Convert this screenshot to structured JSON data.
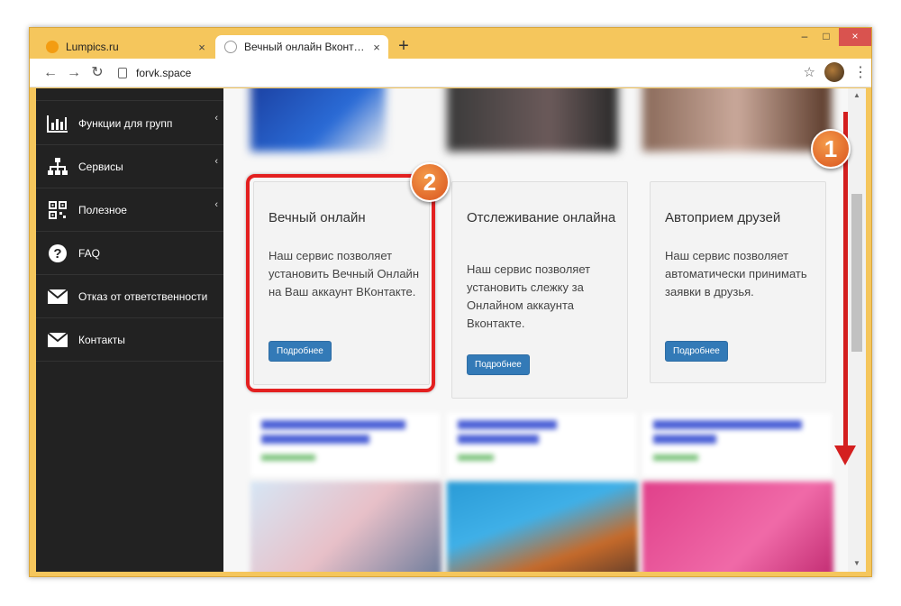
{
  "browser": {
    "tabs": [
      {
        "title": "Lumpics.ru",
        "close": "×",
        "active": false
      },
      {
        "title": "Вечный онлайн Вконтакте, Авто",
        "close": "×",
        "active": true
      }
    ],
    "new_tab": "+",
    "window_controls": {
      "minimize": "–",
      "maximize": "□",
      "close": "×"
    },
    "nav": {
      "back": "←",
      "forward": "→",
      "reload": "↻"
    },
    "url": "forvk.space",
    "star": "☆",
    "menu": "⋮"
  },
  "sidebar": {
    "items": [
      {
        "label": "Функции для групп",
        "icon": "bar-chart-icon",
        "has_submenu": true
      },
      {
        "label": "Сервисы",
        "icon": "sitemap-icon",
        "has_submenu": true
      },
      {
        "label": "Полезное",
        "icon": "qr-code-icon",
        "has_submenu": true
      },
      {
        "label": "FAQ",
        "icon": "question-circle-icon",
        "has_submenu": false
      },
      {
        "label": "Отказ от ответственности",
        "icon": "envelope-icon",
        "has_submenu": false
      },
      {
        "label": "Контакты",
        "icon": "envelope-icon",
        "has_submenu": false
      }
    ],
    "chevron": "‹"
  },
  "cards": [
    {
      "title": "Вечный онлайн",
      "text": "Наш сервис позволяет установить Вечный Онлайн на Ваш аккаунт ВКонтакте.",
      "button": "Подробнее"
    },
    {
      "title": "Отслеживание онлайна",
      "text": "Наш сервис позволяет установить слежку за Онлайном аккаунта Вконтакте.",
      "button": "Подробнее"
    },
    {
      "title": "Автоприем друзей",
      "text": "Наш сервис позволяет автоматически принимать заявки в друзья.",
      "button": "Подробнее"
    }
  ],
  "annotations": {
    "step1": "1",
    "step2": "2"
  },
  "colors": {
    "accent": "#337ab7",
    "sidebar_bg": "#222222",
    "annotation_red": "#e32020",
    "badge_orange": "#e8702a",
    "window_frame": "#f5c65c"
  }
}
